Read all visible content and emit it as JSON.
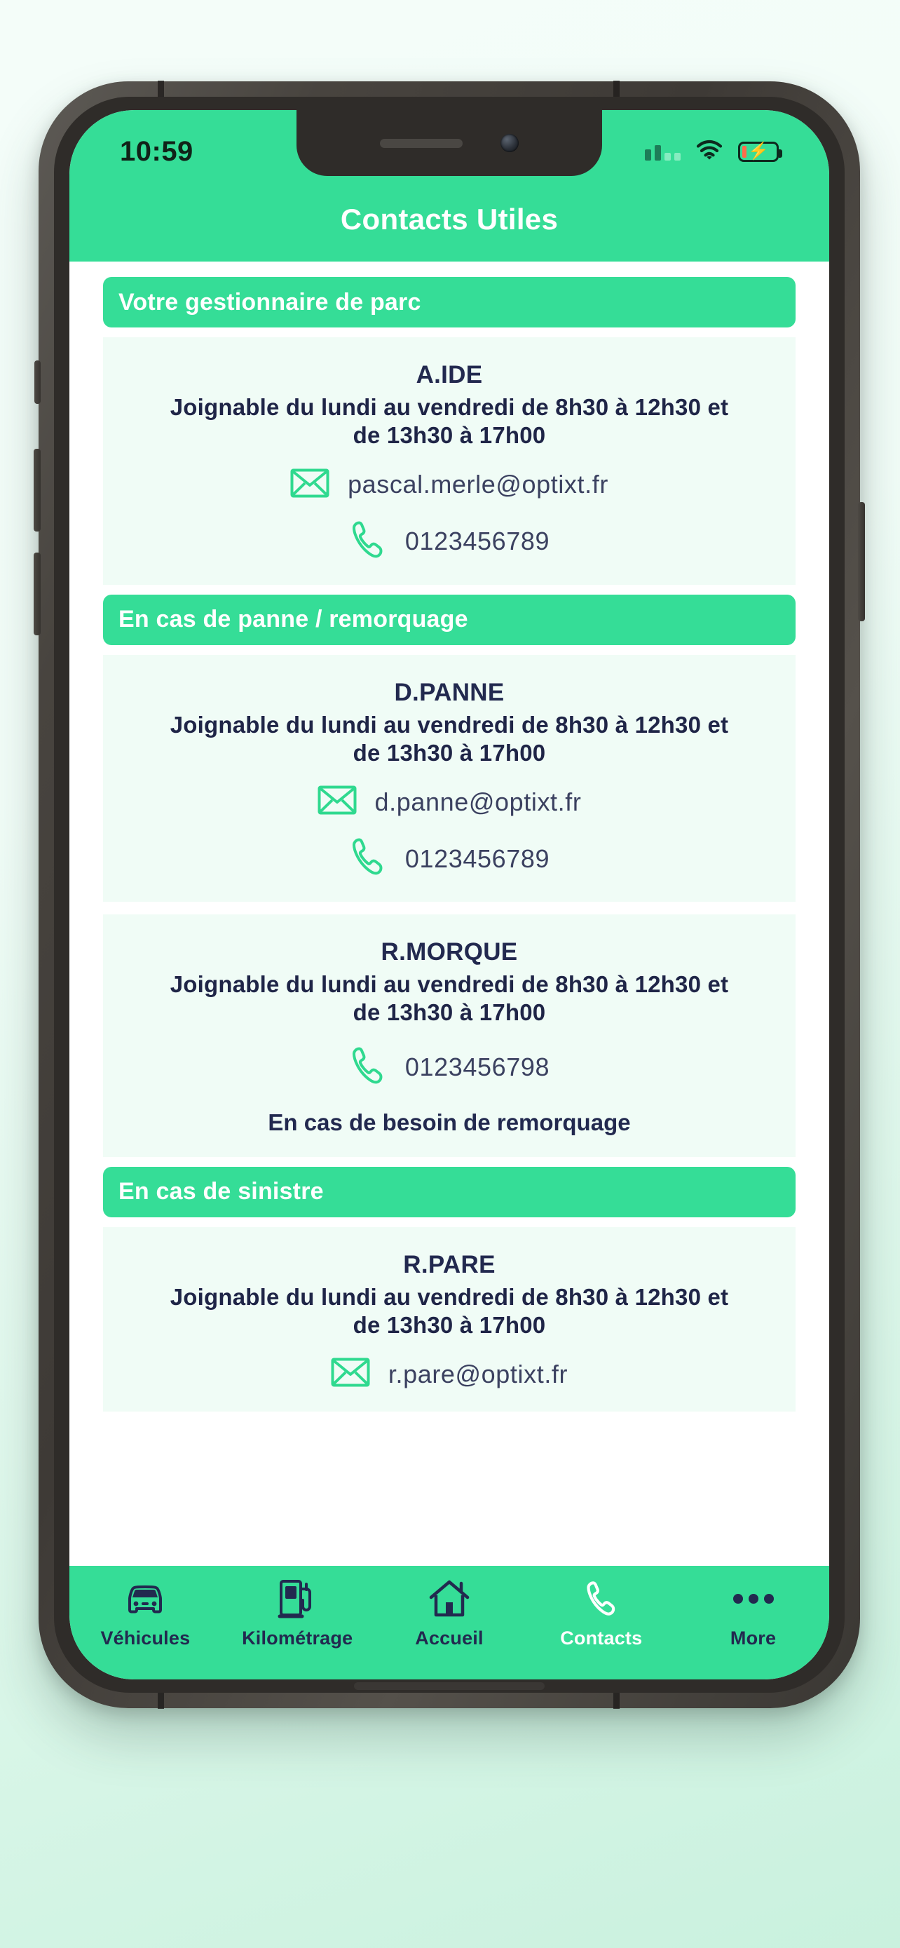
{
  "status_bar": {
    "time": "10:59",
    "icons": [
      "signal-bars-icon",
      "wifi-icon",
      "battery-charging-icon"
    ]
  },
  "header": {
    "title": "Contacts Utiles"
  },
  "colors": {
    "accent_green": "#35dd97",
    "card_bg": "#f0fcf6",
    "navy_text": "#22294f",
    "value_text": "#3b4160",
    "white": "#ffffff"
  },
  "sections": [
    {
      "title": "Votre gestionnaire de parc",
      "cards": [
        {
          "name": "A.IDE",
          "hours": "Joignable du lundi au vendredi de 8h30 à 12h30 et de 13h30 à 17h00",
          "email": "pascal.merle@optixt.fr",
          "phone": "0123456789",
          "note": ""
        }
      ]
    },
    {
      "title": "En cas de panne / remorquage",
      "cards": [
        {
          "name": "D.PANNE",
          "hours": "Joignable du lundi au vendredi de 8h30 à 12h30 et de 13h30 à 17h00",
          "email": "d.panne@optixt.fr",
          "phone": "0123456789",
          "note": ""
        },
        {
          "name": "R.MORQUE",
          "hours": "Joignable du lundi au vendredi de 8h30 à 12h30 et de 13h30 à 17h00",
          "email": "",
          "phone": "0123456798",
          "note": "En cas de besoin de remorquage"
        }
      ]
    },
    {
      "title": "En cas de sinistre",
      "cards": [
        {
          "name": "R.PARE",
          "hours": "Joignable du lundi au vendredi de 8h30 à 12h30 et de 13h30 à 17h00",
          "email": "r.pare@optixt.fr",
          "phone": "",
          "note": ""
        }
      ]
    }
  ],
  "bottom_nav": {
    "items": [
      {
        "label": "Véhicules",
        "icon": "car-icon",
        "active": false
      },
      {
        "label": "Kilométrage",
        "icon": "fuel-pump-icon",
        "active": false
      },
      {
        "label": "Accueil",
        "icon": "home-icon",
        "active": false
      },
      {
        "label": "Contacts",
        "icon": "phone-icon",
        "active": true
      },
      {
        "label": "More",
        "icon": "ellipsis-icon",
        "active": false
      }
    ]
  }
}
